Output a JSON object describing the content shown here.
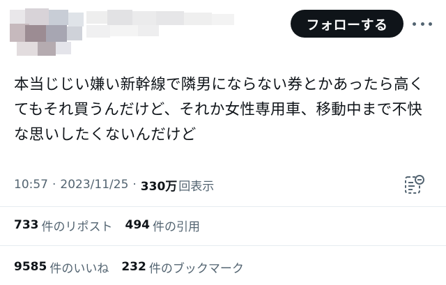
{
  "header": {
    "follow_button": "フォローする"
  },
  "tweet": {
    "text_lines": [
      "本当じじい嫌い新幹線で隣男にならない券とかあったら高く",
      "てもそれ買うんだけど、それか女性専用車、移動中まで不快",
      "な思いしたくないんだけど"
    ]
  },
  "meta": {
    "time": "10:57",
    "separator": "·",
    "date": "2023/11/25",
    "views_number": "330万",
    "views_label": "回表示"
  },
  "stats": {
    "reposts_number": "733",
    "reposts_label": "件のリポスト",
    "quotes_number": "494",
    "quotes_label": "件の引用",
    "likes_number": "9585",
    "likes_label": "件のいいね",
    "bookmarks_number": "232",
    "bookmarks_label": "件のブックマーク"
  },
  "icons": {
    "more": "more-horizontal-icon",
    "analytics": "analytics-icon"
  },
  "colors": {
    "text_primary": "#0f1419",
    "text_secondary": "#536471",
    "button_bg": "#0f1419",
    "divider": "#e6ecf0"
  }
}
